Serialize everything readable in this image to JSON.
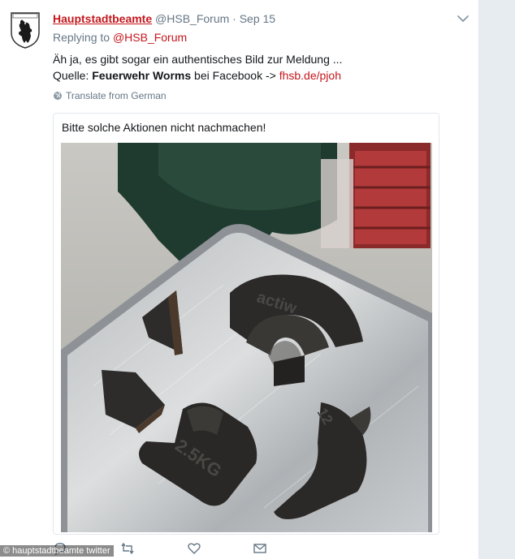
{
  "tweet": {
    "display_name": "Hauptstadtbeamte",
    "handle": "@HSB_Forum",
    "separator": "·",
    "date": "Sep 15",
    "replying_to_prefix": "Replying to",
    "replying_to_handle": "@HSB_Forum",
    "line1": "Äh ja, es gibt sogar ein authentisches Bild zur Meldung ...",
    "source_prefix": "Quelle: ",
    "source_bold": "Feuerwehr Worms",
    "source_middle": " bei Facebook -> ",
    "source_link": "fhsb.de/pjoh",
    "translate_label": "Translate from German"
  },
  "card": {
    "text": "Bitte solche Aktionen nicht nachmachen!"
  },
  "photo": {
    "weight_text_large": "actiw",
    "weight_text_small": "2.5KG",
    "weight_text_right": "12"
  },
  "actions": [
    "reply-icon",
    "retweet-icon",
    "like-icon",
    "message-icon"
  ],
  "credit": "© hauptstadtbeamte twitter",
  "colors": {
    "brand_red": "#c4161c",
    "meta_gray": "#657786",
    "border": "#e1e8ed"
  }
}
